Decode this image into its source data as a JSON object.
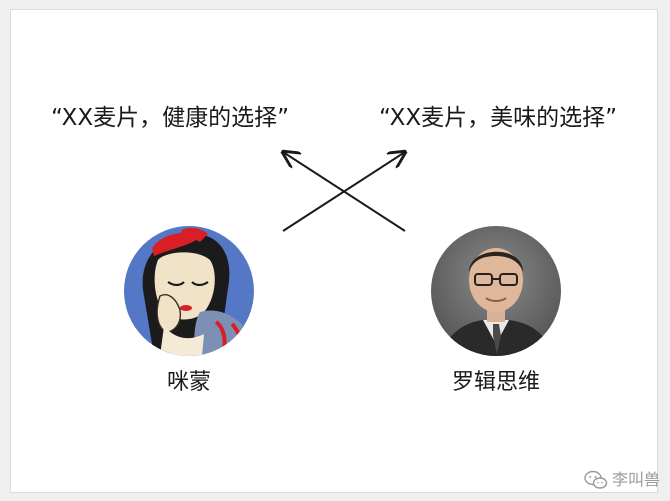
{
  "quotes": {
    "left": "“XX麦片，健康的选择”",
    "right": "“XX麦片，美味的选择”"
  },
  "people": {
    "left": {
      "name": "咪蒙",
      "avatar_icon": "snow-white-cartoon-avatar"
    },
    "right": {
      "name": "罗辑思维",
      "avatar_icon": "man-with-glasses-photo-avatar"
    }
  },
  "watermark": {
    "text": "李叫兽",
    "icon": "wechat-icon"
  },
  "colors": {
    "text": "#1a1a1a",
    "arrow": "#1a1a1a",
    "watermark": "#9a9a9a",
    "left_avatar_bg": "#5578c6",
    "right_avatar_bg": "#6f6f6f"
  }
}
